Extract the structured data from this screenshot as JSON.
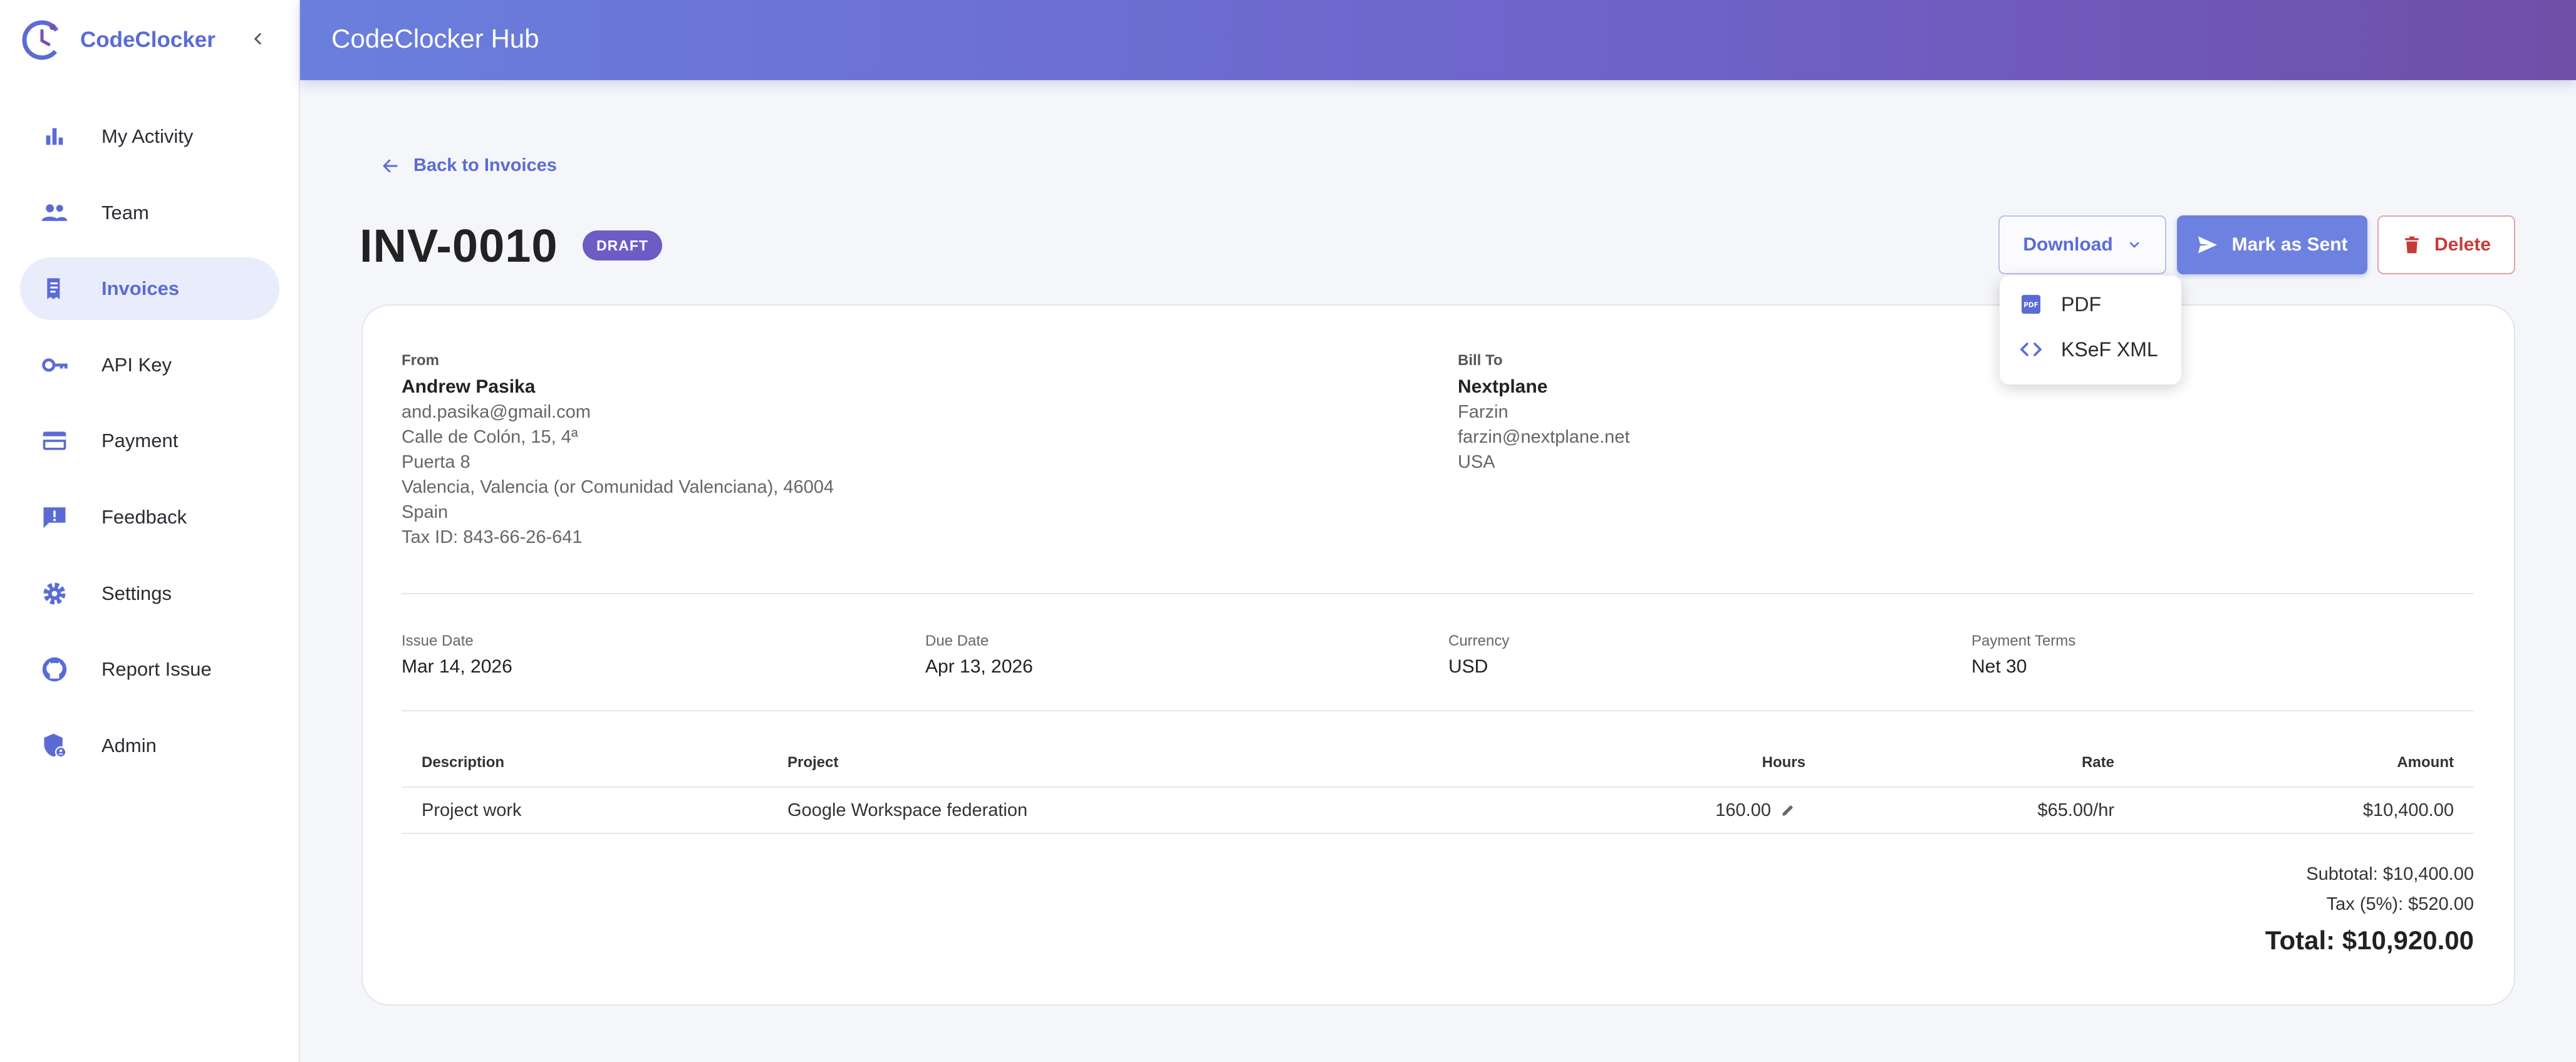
{
  "app": {
    "name": "CodeClocker",
    "header_title": "CodeClocker Hub"
  },
  "colors": {
    "accent": "#5b6bd6",
    "draft_badge": "#6c5cc4",
    "danger": "#c73a3a"
  },
  "sidebar": {
    "items": [
      {
        "label": "My Activity",
        "icon": "bar-chart-icon",
        "active": false
      },
      {
        "label": "Team",
        "icon": "people-icon",
        "active": false
      },
      {
        "label": "Invoices",
        "icon": "receipt-icon",
        "active": true
      },
      {
        "label": "API Key",
        "icon": "key-icon",
        "active": false
      },
      {
        "label": "Payment",
        "icon": "credit-card-icon",
        "active": false
      },
      {
        "label": "Feedback",
        "icon": "feedback-icon",
        "active": false
      },
      {
        "label": "Settings",
        "icon": "gear-icon",
        "active": false
      },
      {
        "label": "Report Issue",
        "icon": "github-icon",
        "active": false
      },
      {
        "label": "Admin",
        "icon": "admin-shield-icon",
        "active": false
      }
    ]
  },
  "invoice": {
    "back_label": "Back to Invoices",
    "number": "INV-0010",
    "status": "DRAFT",
    "actions": {
      "download": "Download",
      "mark_sent": "Mark as Sent",
      "delete": "Delete"
    },
    "download_menu": [
      "PDF",
      "KSeF XML"
    ],
    "from": {
      "caption": "From",
      "name": "Andrew Pasika",
      "lines": [
        "and.pasika@gmail.com",
        "Calle de Colón, 15, 4ª",
        "Puerta 8",
        "Valencia, Valencia (or Comunidad Valenciana), 46004",
        "Spain",
        "Tax ID: 843-66-26-641"
      ]
    },
    "bill_to": {
      "caption": "Bill To",
      "name": "Nextplane",
      "lines": [
        "Farzin",
        "farzin@nextplane.net",
        "USA"
      ]
    },
    "meta": [
      {
        "caption": "Issue Date",
        "value": "Mar 14, 2026"
      },
      {
        "caption": "Due Date",
        "value": "Apr 13, 2026"
      },
      {
        "caption": "Currency",
        "value": "USD"
      },
      {
        "caption": "Payment Terms",
        "value": "Net 30"
      }
    ],
    "table": {
      "headers": [
        "Description",
        "Project",
        "Hours",
        "Rate",
        "Amount"
      ],
      "rows": [
        {
          "description": "Project work",
          "project": "Google Workspace federation",
          "hours": "160.00",
          "rate": "$65.00/hr",
          "amount": "$10,400.00"
        }
      ]
    },
    "subtotal": "Subtotal: $10,400.00",
    "tax": "Tax (5%): $520.00",
    "total": "Total: $10,920.00"
  }
}
